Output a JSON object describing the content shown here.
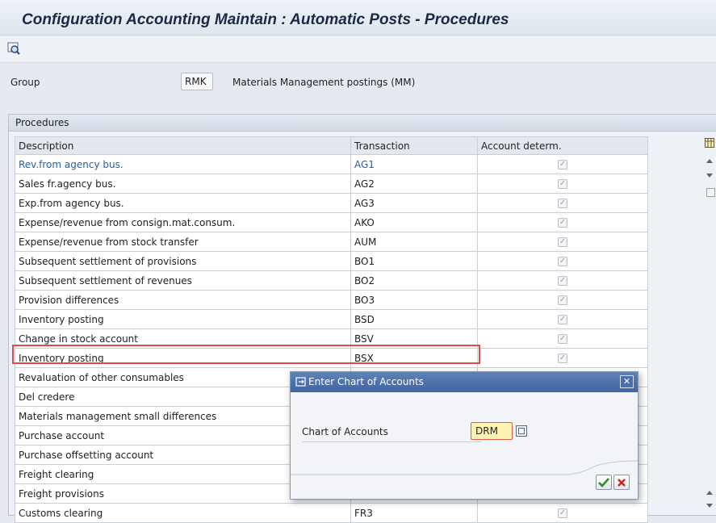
{
  "window": {
    "title": "Configuration Accounting Maintain : Automatic Posts - Procedures"
  },
  "toolbar": {
    "icons": [
      "display-object-icon"
    ]
  },
  "group": {
    "label": "Group",
    "value": "RMK",
    "description": "Materials Management postings (MM)"
  },
  "procedures": {
    "panel_title": "Procedures",
    "columns": [
      "Description",
      "Transaction",
      "Account determ."
    ],
    "rows": [
      {
        "description": "Rev.from agency bus.",
        "transaction": "AG1",
        "checked": true
      },
      {
        "description": "Sales fr.agency bus.",
        "transaction": "AG2",
        "checked": true
      },
      {
        "description": "Exp.from agency bus.",
        "transaction": "AG3",
        "checked": true
      },
      {
        "description": "Expense/revenue from consign.mat.consum.",
        "transaction": "AKO",
        "checked": true
      },
      {
        "description": "Expense/revenue from stock transfer",
        "transaction": "AUM",
        "checked": true
      },
      {
        "description": "Subsequent settlement of provisions",
        "transaction": "BO1",
        "checked": true
      },
      {
        "description": "Subsequent settlement of revenues",
        "transaction": "BO2",
        "checked": true
      },
      {
        "description": "Provision differences",
        "transaction": "BO3",
        "checked": true
      },
      {
        "description": "Inventory posting",
        "transaction": "BSD",
        "checked": true
      },
      {
        "description": "Change in stock account",
        "transaction": "BSV",
        "checked": true
      },
      {
        "description": "Inventory posting",
        "transaction": "BSX",
        "checked": true
      },
      {
        "description": "Revaluation of other consumables",
        "transaction": "",
        "checked": false
      },
      {
        "description": "Del credere",
        "transaction": "",
        "checked": false
      },
      {
        "description": "Materials management small differences",
        "transaction": "",
        "checked": false
      },
      {
        "description": "Purchase account",
        "transaction": "",
        "checked": false
      },
      {
        "description": "Purchase offsetting account",
        "transaction": "",
        "checked": false
      },
      {
        "description": "Freight clearing",
        "transaction": "",
        "checked": false
      },
      {
        "description": "Freight provisions",
        "transaction": "",
        "checked": false
      },
      {
        "description": "Customs clearing",
        "transaction": "FR3",
        "checked": true
      }
    ]
  },
  "dialog": {
    "title": "Enter Chart of Accounts",
    "field_label": "Chart of Accounts",
    "field_value": "DRM"
  },
  "colors": {
    "highlight": "#e04a4a",
    "link": "#2a5da8",
    "dialog_title": "#3f64a0"
  }
}
